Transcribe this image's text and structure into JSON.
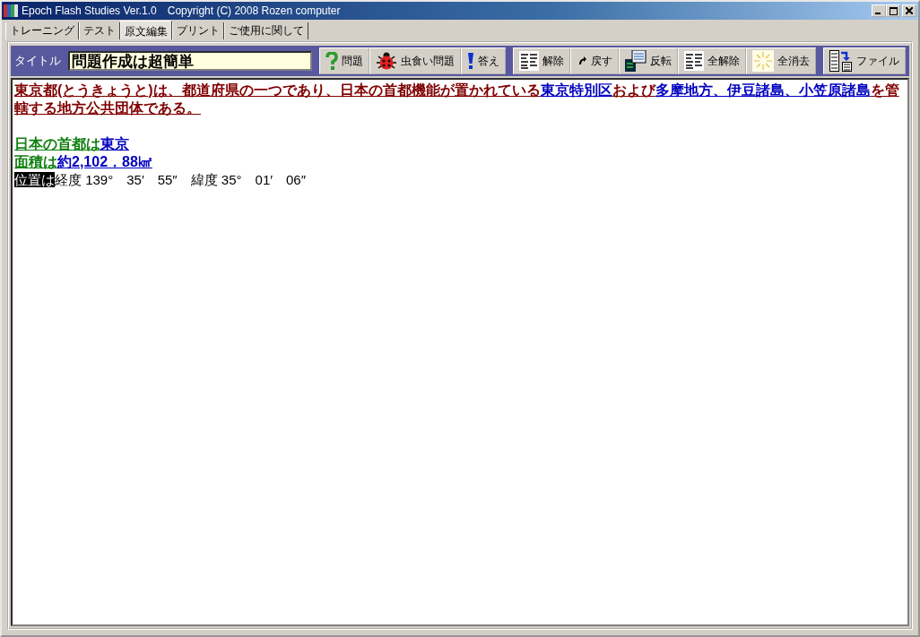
{
  "window": {
    "title": "Epoch Flash Studies Ver.1.0　Copyright (C) 2008 Rozen computer"
  },
  "tabs": [
    {
      "label": "トレーニング",
      "selected": false
    },
    {
      "label": "テスト",
      "selected": false
    },
    {
      "label": "原文編集",
      "selected": true
    },
    {
      "label": "プリント",
      "selected": false
    },
    {
      "label": "ご使用に関して",
      "selected": false
    }
  ],
  "toolbar": {
    "title_label": "タイトル",
    "title_value": "問題作成は超簡単",
    "groups": [
      [
        {
          "label": "問題",
          "kind": "question"
        },
        {
          "label": "虫食い問題",
          "kind": "ladybug"
        },
        {
          "label": "答え",
          "kind": "exclamation"
        }
      ],
      [
        {
          "label": "解除",
          "kind": "lines"
        },
        {
          "label": "戻す",
          "kind": "undo"
        },
        {
          "label": "反転",
          "kind": "screen"
        },
        {
          "label": "全解除",
          "kind": "lines"
        },
        {
          "label": "全消去",
          "kind": "sparkle"
        }
      ],
      [
        {
          "label": "ファイル",
          "kind": "file"
        }
      ]
    ]
  },
  "editor": {
    "paragraphs": [
      [
        {
          "kind": "text",
          "text": "東京都(とうきょうと)は、都道府県の一つであり、日本の首都機能が置かれている"
        },
        {
          "kind": "term",
          "text": "東京特別区"
        },
        {
          "kind": "text",
          "text": "および"
        },
        {
          "kind": "term",
          "text": "多摩地方、伊豆諸島、小笠原諸島"
        },
        {
          "kind": "text",
          "text": "を管轄する地方公共団体である。"
        }
      ],
      [
        {
          "kind": "label",
          "text": "日本の首都は"
        },
        {
          "kind": "term",
          "text": "東京"
        }
      ],
      [
        {
          "kind": "label",
          "text": "面積は"
        },
        {
          "kind": "term",
          "text": "約2,102．88㎢"
        }
      ],
      [
        {
          "kind": "selected",
          "text": "位置は"
        },
        {
          "kind": "plain",
          "text": "経度 139°　35′　55″　緯度 35°　01′　06″"
        }
      ]
    ]
  }
}
